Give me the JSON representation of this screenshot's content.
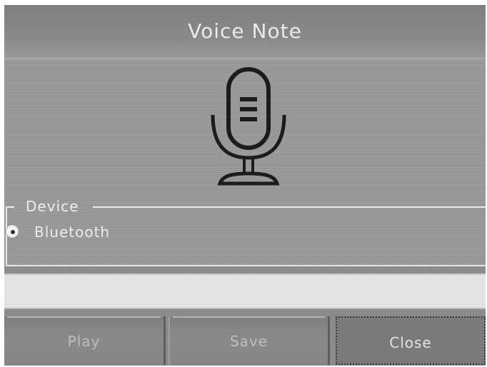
{
  "window": {
    "title": "Voice Note"
  },
  "device_group": {
    "legend": "Device",
    "options": [
      {
        "label": "Bluetooth",
        "selected": true
      }
    ]
  },
  "icons": {
    "main": "microphone-icon"
  },
  "buttons": {
    "play": "Play",
    "save": "Save",
    "close": "Close"
  },
  "colors": {
    "background": "#8e8e8e",
    "text": "#ececec",
    "disabled_text": "#bdbdbd",
    "status_bar": "#e3e3e3"
  }
}
